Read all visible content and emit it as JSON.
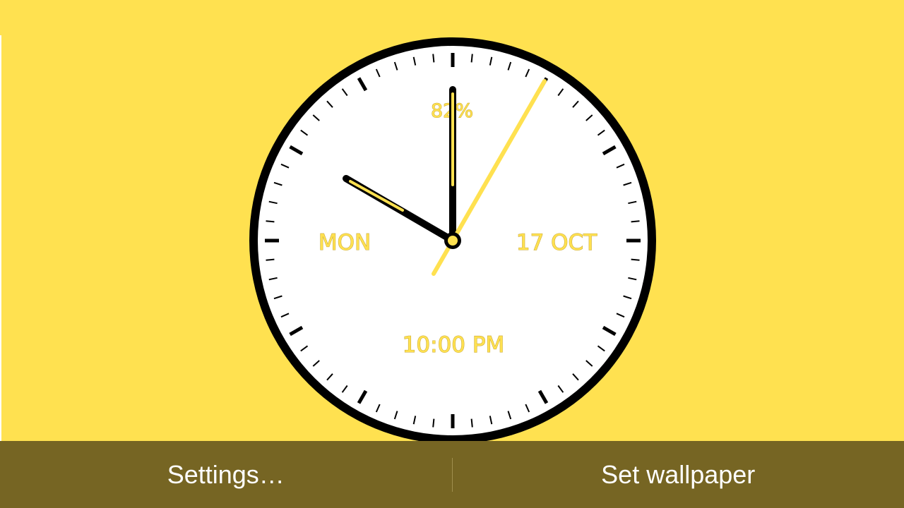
{
  "clock": {
    "battery": "82%",
    "day": "MON",
    "date": "17 OCT",
    "time": "10:00 PM",
    "colors": {
      "accent": "#ffe150",
      "rim": "#000000",
      "face": "#ffffff"
    }
  },
  "bottom_bar": {
    "settings_label": "Settings…",
    "set_wallpaper_label": "Set wallpaper",
    "background": "#766523"
  },
  "background_color": "#ffe150"
}
